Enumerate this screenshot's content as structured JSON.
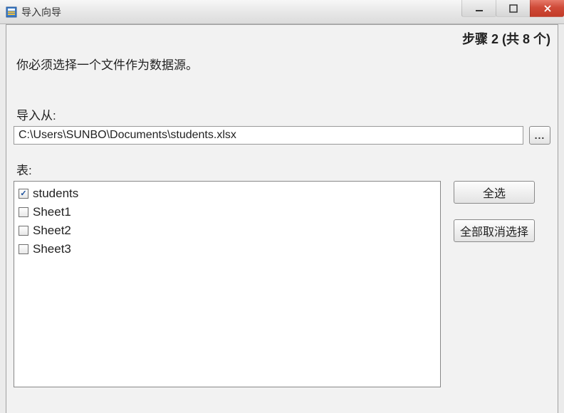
{
  "window": {
    "title": "导入向导"
  },
  "step": {
    "text": "步骤 2 (共 8 个)"
  },
  "instruction": "你必须选择一个文件作为数据源。",
  "import_from_label": "导入从:",
  "file_path": "C:\\Users\\SUNBO\\Documents\\students.xlsx",
  "browse_label": "...",
  "tables_label": "表:",
  "tables": [
    {
      "name": "students",
      "checked": true
    },
    {
      "name": "Sheet1",
      "checked": false
    },
    {
      "name": "Sheet2",
      "checked": false
    },
    {
      "name": "Sheet3",
      "checked": false
    }
  ],
  "buttons": {
    "select_all": "全选",
    "deselect_all": "全部取消选择"
  }
}
